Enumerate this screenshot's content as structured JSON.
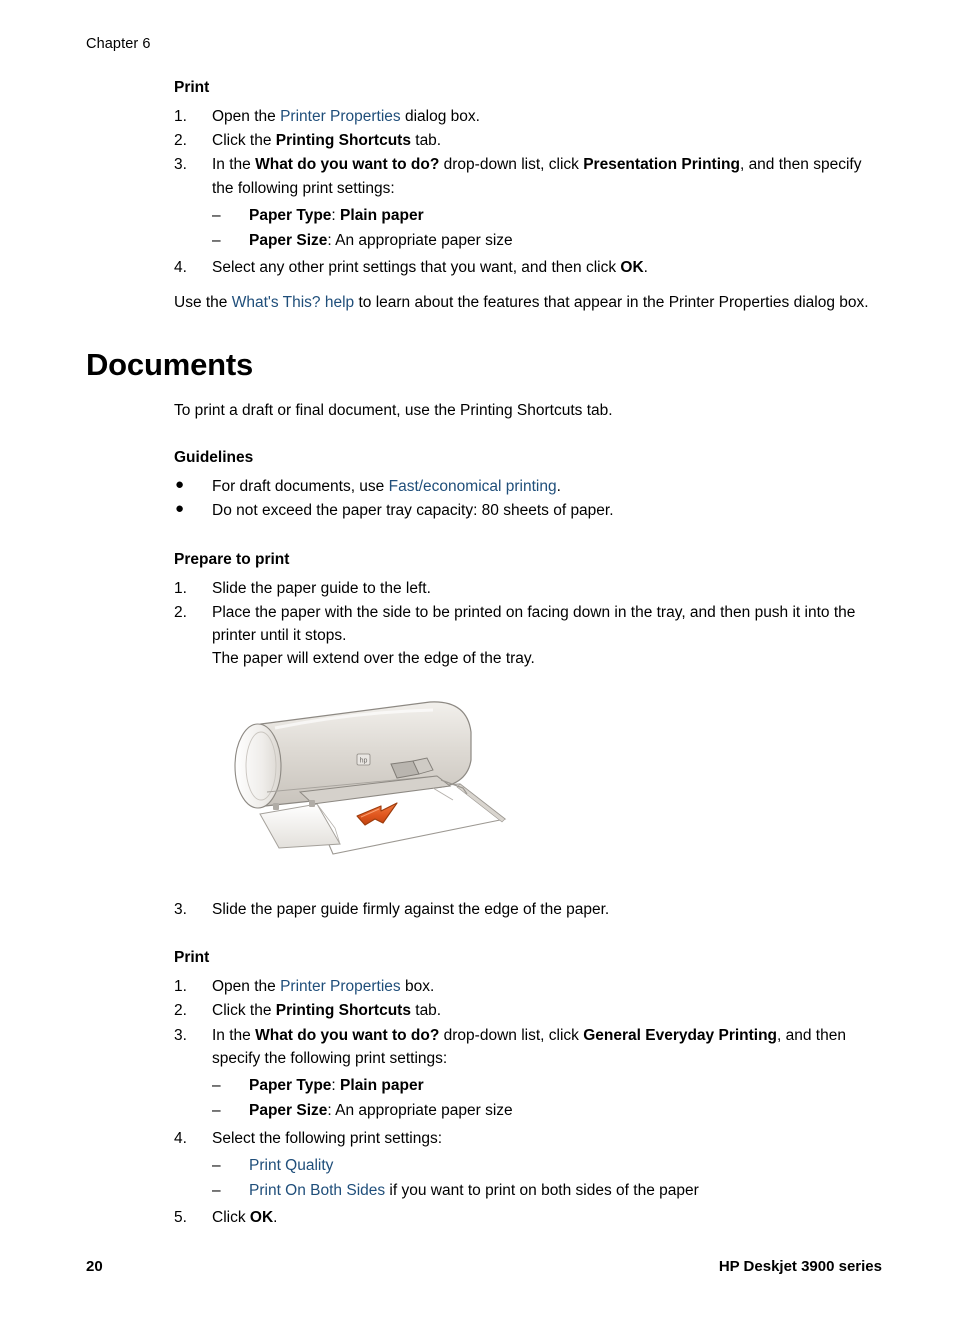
{
  "header": {
    "chapter": "Chapter 6"
  },
  "section_presentation_print": {
    "heading": "Print",
    "steps": [
      {
        "num": "1.",
        "parts": [
          {
            "t": "Open the ",
            "s": "plain"
          },
          {
            "t": "Printer Properties",
            "s": "link"
          },
          {
            "t": " dialog box.",
            "s": "plain"
          }
        ]
      },
      {
        "num": "2.",
        "parts": [
          {
            "t": "Click the ",
            "s": "plain"
          },
          {
            "t": "Printing Shortcuts",
            "s": "bold"
          },
          {
            "t": " tab.",
            "s": "plain"
          }
        ]
      },
      {
        "num": "3.",
        "parts": [
          {
            "t": "In the ",
            "s": "plain"
          },
          {
            "t": "What do you want to do?",
            "s": "bold"
          },
          {
            "t": " drop-down list, click ",
            "s": "plain"
          },
          {
            "t": "Presentation Printing",
            "s": "bold"
          },
          {
            "t": ", and then specify the following print settings:",
            "s": "plain"
          }
        ],
        "sub": [
          {
            "dash": "–",
            "parts": [
              {
                "t": "Paper Type",
                "s": "bold"
              },
              {
                "t": ": ",
                "s": "plain"
              },
              {
                "t": "Plain paper",
                "s": "bold"
              }
            ]
          },
          {
            "dash": "–",
            "parts": [
              {
                "t": "Paper Size",
                "s": "bold"
              },
              {
                "t": ": An appropriate paper size",
                "s": "plain"
              }
            ]
          }
        ]
      },
      {
        "num": "4.",
        "parts": [
          {
            "t": "Select any other print settings that you want, and then click ",
            "s": "plain"
          },
          {
            "t": "OK",
            "s": "bold"
          },
          {
            "t": ".",
            "s": "plain"
          }
        ]
      }
    ],
    "closing_paragraph": [
      {
        "t": "Use the ",
        "s": "plain"
      },
      {
        "t": "What's This? help",
        "s": "link"
      },
      {
        "t": " to learn about the features that appear in the Printer Properties dialog box.",
        "s": "plain"
      }
    ]
  },
  "section_documents": {
    "title": "Documents",
    "intro": "To print a draft or final document, use the Printing Shortcuts tab.",
    "guidelines": {
      "heading": "Guidelines",
      "items": [
        {
          "bullet": "●",
          "parts": [
            {
              "t": "For draft documents, use ",
              "s": "plain"
            },
            {
              "t": "Fast/economical printing",
              "s": "link"
            },
            {
              "t": ".",
              "s": "plain"
            }
          ]
        },
        {
          "bullet": "●",
          "parts": [
            {
              "t": "Do not exceed the paper tray capacity: 80 sheets of paper.",
              "s": "plain"
            }
          ]
        }
      ]
    },
    "prepare_to_print": {
      "heading": "Prepare to print",
      "steps": [
        {
          "num": "1.",
          "parts": [
            {
              "t": "Slide the paper guide to the left.",
              "s": "plain"
            }
          ]
        },
        {
          "num": "2.",
          "parts": [
            {
              "t": "Place the paper with the side to be printed on facing down in the tray, and then push it into the printer until it stops.",
              "s": "plain"
            },
            {
              "t": "\n",
              "s": "break"
            },
            {
              "t": "The paper will extend over the edge of the tray.",
              "s": "plain"
            }
          ]
        }
      ],
      "step_after_figure": {
        "num": "3.",
        "parts": [
          {
            "t": "Slide the paper guide firmly against the edge of the paper.",
            "s": "plain"
          }
        ]
      }
    },
    "print": {
      "heading": "Print",
      "steps": [
        {
          "num": "1.",
          "parts": [
            {
              "t": "Open the ",
              "s": "plain"
            },
            {
              "t": "Printer Properties",
              "s": "link"
            },
            {
              "t": " box.",
              "s": "plain"
            }
          ]
        },
        {
          "num": "2.",
          "parts": [
            {
              "t": "Click the ",
              "s": "plain"
            },
            {
              "t": "Printing Shortcuts",
              "s": "bold"
            },
            {
              "t": " tab.",
              "s": "plain"
            }
          ]
        },
        {
          "num": "3.",
          "parts": [
            {
              "t": "In the ",
              "s": "plain"
            },
            {
              "t": "What do you want to do?",
              "s": "bold"
            },
            {
              "t": " drop-down list, click ",
              "s": "plain"
            },
            {
              "t": "General Everyday Printing",
              "s": "bold"
            },
            {
              "t": ", and then specify the following print settings:",
              "s": "plain"
            }
          ],
          "sub": [
            {
              "dash": "–",
              "parts": [
                {
                  "t": "Paper Type",
                  "s": "bold"
                },
                {
                  "t": ": ",
                  "s": "plain"
                },
                {
                  "t": "Plain paper",
                  "s": "bold"
                }
              ]
            },
            {
              "dash": "–",
              "parts": [
                {
                  "t": "Paper Size",
                  "s": "bold"
                },
                {
                  "t": ": An appropriate paper size",
                  "s": "plain"
                }
              ]
            }
          ]
        },
        {
          "num": "4.",
          "parts": [
            {
              "t": "Select the following print settings:",
              "s": "plain"
            }
          ],
          "sub": [
            {
              "dash": "–",
              "parts": [
                {
                  "t": "Print Quality",
                  "s": "link"
                }
              ]
            },
            {
              "dash": "–",
              "parts": [
                {
                  "t": "Print On Both Sides",
                  "s": "link"
                },
                {
                  "t": " if you want to print on both sides of the paper",
                  "s": "plain"
                }
              ]
            }
          ]
        },
        {
          "num": "5.",
          "parts": [
            {
              "t": "Click ",
              "s": "plain"
            },
            {
              "t": "OK",
              "s": "bold"
            },
            {
              "t": ".",
              "s": "plain"
            }
          ]
        }
      ]
    }
  },
  "figure": {
    "alt": "HP Deskjet printer with plain paper loaded in the input tray and an orange arrow indicating the print side faces down",
    "colors": {
      "body_light": "#e7e4df",
      "body_mid": "#cdc9c3",
      "outline": "#8a8681",
      "paper": "#ffffff",
      "arrow": "#e05a24"
    }
  },
  "footer": {
    "page_number": "20",
    "product": "HP Deskjet 3900 series"
  },
  "theme": {
    "link_color": "#1F4E7A",
    "text_color": "#000000",
    "background": "#ffffff"
  }
}
